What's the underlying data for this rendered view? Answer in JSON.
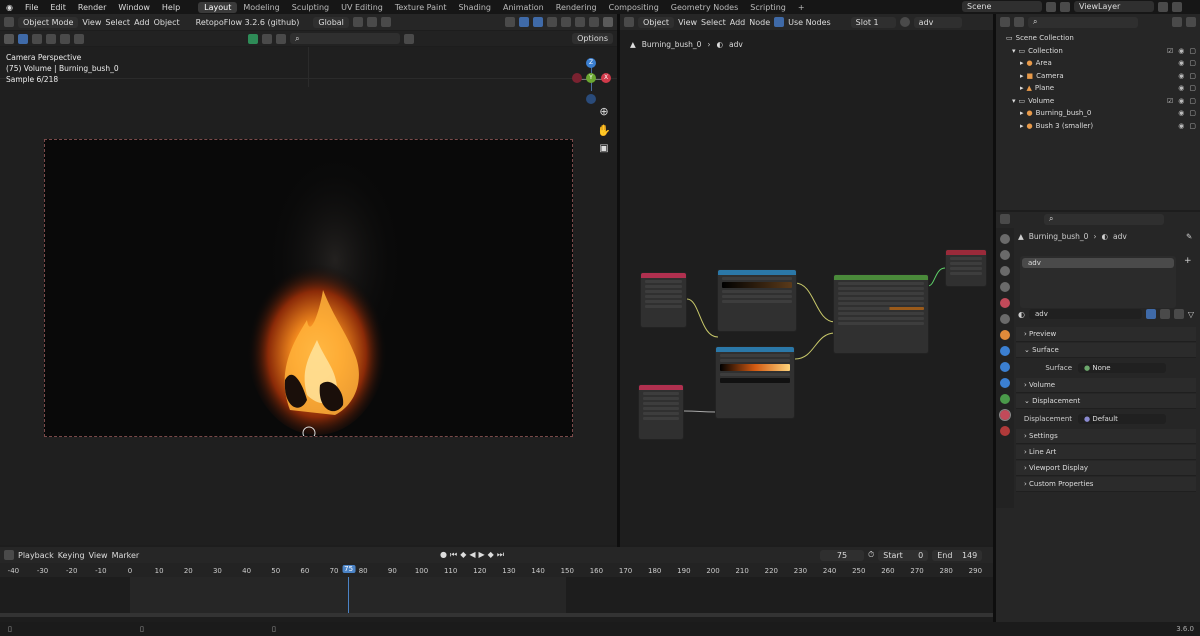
{
  "topbar": {
    "menus": [
      "File",
      "Edit",
      "Render",
      "Window",
      "Help"
    ],
    "workspaces": [
      "Layout",
      "Modeling",
      "Sculpting",
      "UV Editing",
      "Texture Paint",
      "Shading",
      "Animation",
      "Rendering",
      "Compositing",
      "Geometry Nodes",
      "Scripting"
    ],
    "active_workspace": "Layout",
    "scene_label": "Scene",
    "viewlayer_label": "ViewLayer"
  },
  "viewport": {
    "mode": "Object Mode",
    "menus": [
      "View",
      "Select",
      "Add",
      "Object"
    ],
    "addon": "RetopoFlow 3.2.6 (github)",
    "orientation": "Global",
    "options": "Options",
    "overlay_lines": [
      "Camera Perspective",
      "(75) Volume | Burning_bush_0",
      "Sample 6/218"
    ],
    "gizmo": {
      "z": "Z",
      "y": "Y",
      "x": "X"
    }
  },
  "node_editor": {
    "object": "Object",
    "menus": [
      "View",
      "Select",
      "Add",
      "Node"
    ],
    "use_nodes": "Use Nodes",
    "slot": "Slot 1",
    "material": "adv",
    "breadcrumb_object": "Burning_bush_0",
    "breadcrumb_material": "adv"
  },
  "outliner": {
    "rows": [
      {
        "label": "Scene Collection",
        "indent": 0
      },
      {
        "label": "Collection",
        "indent": 1
      },
      {
        "label": "Area",
        "indent": 2
      },
      {
        "label": "Camera",
        "indent": 2
      },
      {
        "label": "Plane",
        "indent": 2
      },
      {
        "label": "Volume",
        "indent": 1
      },
      {
        "label": "Burning_bush_0",
        "indent": 2
      },
      {
        "label": "Bush 3 (smaller)",
        "indent": 2
      }
    ]
  },
  "properties": {
    "object": "Burning_bush_0",
    "material": "adv",
    "slot_name": "adv",
    "material_field": "adv",
    "sections": {
      "preview": "Preview",
      "surface": "Surface",
      "surface_label": "Surface",
      "surface_value": "None",
      "volume": "Volume",
      "displacement": "Displacement",
      "displacement_label": "Displacement",
      "displacement_value": "Default",
      "settings": "Settings",
      "line_art": "Line Art",
      "viewport_display": "Viewport Display",
      "custom_properties": "Custom Properties"
    }
  },
  "timeline": {
    "menus": [
      "Playback",
      "Keying",
      "View",
      "Marker"
    ],
    "current_frame": "75",
    "start_label": "Start",
    "start": "0",
    "end_label": "End",
    "end": "149",
    "ticks": [
      "-40",
      "-30",
      "-20",
      "-10",
      "0",
      "10",
      "20",
      "30",
      "40",
      "50",
      "60",
      "70",
      "75",
      "80",
      "90",
      "100",
      "110",
      "120",
      "130",
      "140",
      "150",
      "160",
      "170",
      "180",
      "190",
      "200",
      "210",
      "220",
      "230",
      "240",
      "250",
      "260",
      "270",
      "280",
      "290"
    ]
  },
  "status": {
    "version": "3.6.0"
  }
}
